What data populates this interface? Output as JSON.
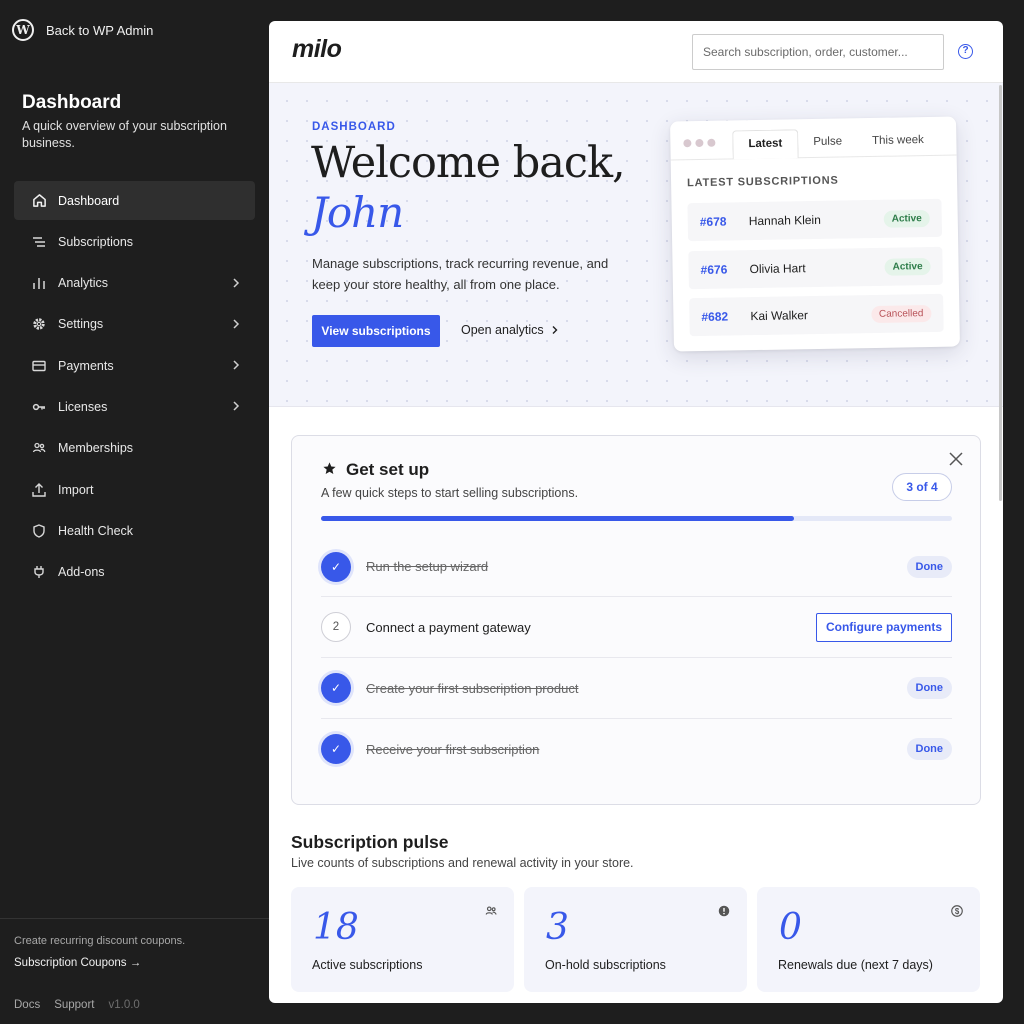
{
  "sidebar": {
    "back_label": "Back to WP Admin",
    "title": "Dashboard",
    "subtitle": "A quick overview of your subscription business.",
    "items": [
      {
        "label": "Dashboard",
        "icon": "home-icon",
        "active": true,
        "chevron": false
      },
      {
        "label": "Subscriptions",
        "icon": "list-icon",
        "active": false,
        "chevron": false
      },
      {
        "label": "Analytics",
        "icon": "bar-chart-icon",
        "active": false,
        "chevron": true
      },
      {
        "label": "Settings",
        "icon": "gear-icon",
        "active": false,
        "chevron": true
      },
      {
        "label": "Payments",
        "icon": "credit-card-icon",
        "active": false,
        "chevron": true
      },
      {
        "label": "Licenses",
        "icon": "key-icon",
        "active": false,
        "chevron": true
      },
      {
        "label": "Memberships",
        "icon": "people-icon",
        "active": false,
        "chevron": false
      },
      {
        "label": "Import",
        "icon": "upload-icon",
        "active": false,
        "chevron": false
      },
      {
        "label": "Health Check",
        "icon": "shield-icon",
        "active": false,
        "chevron": false
      },
      {
        "label": "Add-ons",
        "icon": "plug-icon",
        "active": false,
        "chevron": false
      }
    ],
    "promo_text": "Create recurring discount coupons.",
    "promo_link": "Subscription Coupons →",
    "footer": {
      "docs": "Docs",
      "support": "Support",
      "version": "v1.0.0"
    }
  },
  "header": {
    "logo": "milo",
    "search_placeholder": "Search subscription, order, customer...",
    "help_icon": "help-circle-icon"
  },
  "hero": {
    "eyebrow": "DASHBOARD",
    "welcome": "Welcome back,",
    "name": "John",
    "description": "Manage subscriptions, track recurring revenue, and keep your store healthy, all from one place.",
    "primary_button": "View subscriptions",
    "secondary_link": "Open analytics",
    "card": {
      "tabs": [
        "Latest",
        "Pulse",
        "This week"
      ],
      "active_tab": 0,
      "title": "LATEST SUBSCRIPTIONS",
      "rows": [
        {
          "id": "#678",
          "name": "Hannah Klein",
          "status": "Active",
          "status_type": "active"
        },
        {
          "id": "#676",
          "name": "Olivia Hart",
          "status": "Active",
          "status_type": "active"
        },
        {
          "id": "#682",
          "name": "Kai Walker",
          "status": "Cancelled",
          "status_type": "cancelled"
        }
      ]
    }
  },
  "setup": {
    "title": "Get set up",
    "subtitle": "A few quick steps to start selling subscriptions.",
    "count": "3 of 4",
    "progress": 0.75,
    "steps": [
      {
        "label": "Run the setup wizard",
        "done": true,
        "action": "Done"
      },
      {
        "label": "Connect a payment gateway",
        "done": false,
        "number": "2",
        "action": "Configure payments"
      },
      {
        "label": "Create your first subscription product",
        "done": true,
        "action": "Done"
      },
      {
        "label": "Receive your first subscription",
        "done": true,
        "action": "Done"
      }
    ]
  },
  "pulse": {
    "title": "Subscription pulse",
    "subtitle": "Live counts of subscriptions and renewal activity in your store.",
    "stats": [
      {
        "value": "18",
        "label": "Active subscriptions",
        "icon": "people-icon"
      },
      {
        "value": "3",
        "label": "On-hold subscriptions",
        "icon": "alert-icon"
      },
      {
        "value": "0",
        "label": "Renewals due (next 7 days)",
        "icon": "dollar-icon"
      }
    ]
  },
  "colors": {
    "accent": "#3858e9",
    "sidebar_bg": "#1e1e1e",
    "hero_bg": "#f3f4fb"
  }
}
